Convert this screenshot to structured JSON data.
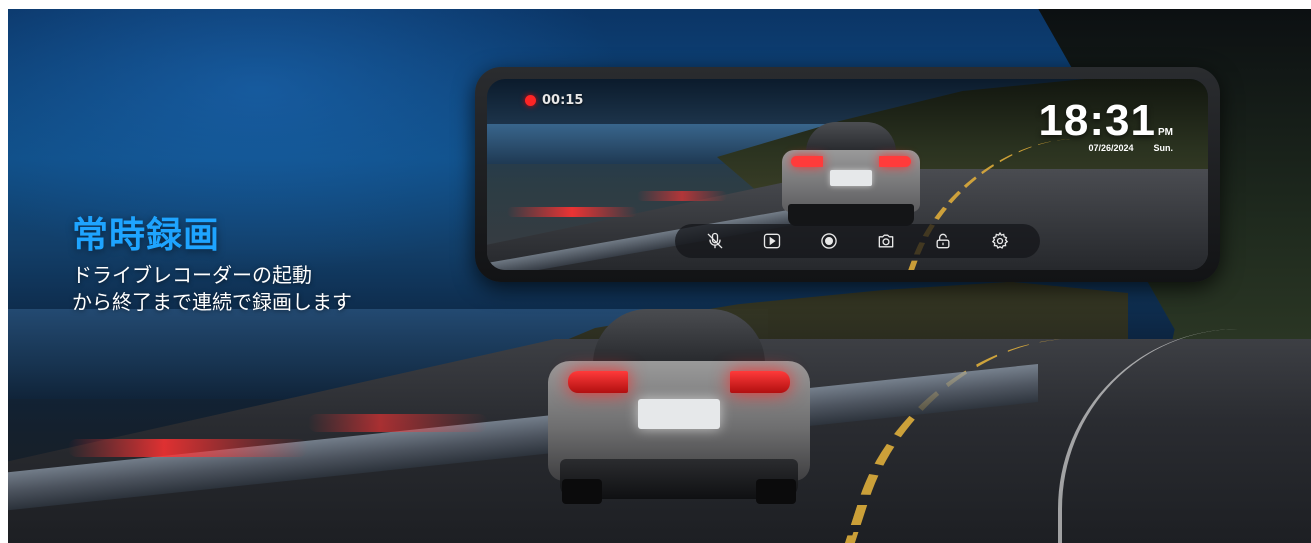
{
  "headline": "常時録画",
  "description": {
    "line1": "ドライブレコーダーの起動",
    "line2": "から終了まで連続で録画します"
  },
  "mirror": {
    "recording": {
      "status": "recording",
      "elapsed": "00:15",
      "indicator_color": "#ff2525"
    },
    "clock": {
      "time": "18:31",
      "period": "PM",
      "date": "07/26/2024",
      "weekday": "Sun."
    },
    "controls": [
      {
        "name": "mic-muted-icon"
      },
      {
        "name": "play-icon"
      },
      {
        "name": "record-icon"
      },
      {
        "name": "camera-icon"
      },
      {
        "name": "lock-icon"
      },
      {
        "name": "settings-gear-icon"
      }
    ]
  },
  "colors": {
    "headline_accent": "#1ea4ff",
    "recording_red": "#ff2525"
  }
}
